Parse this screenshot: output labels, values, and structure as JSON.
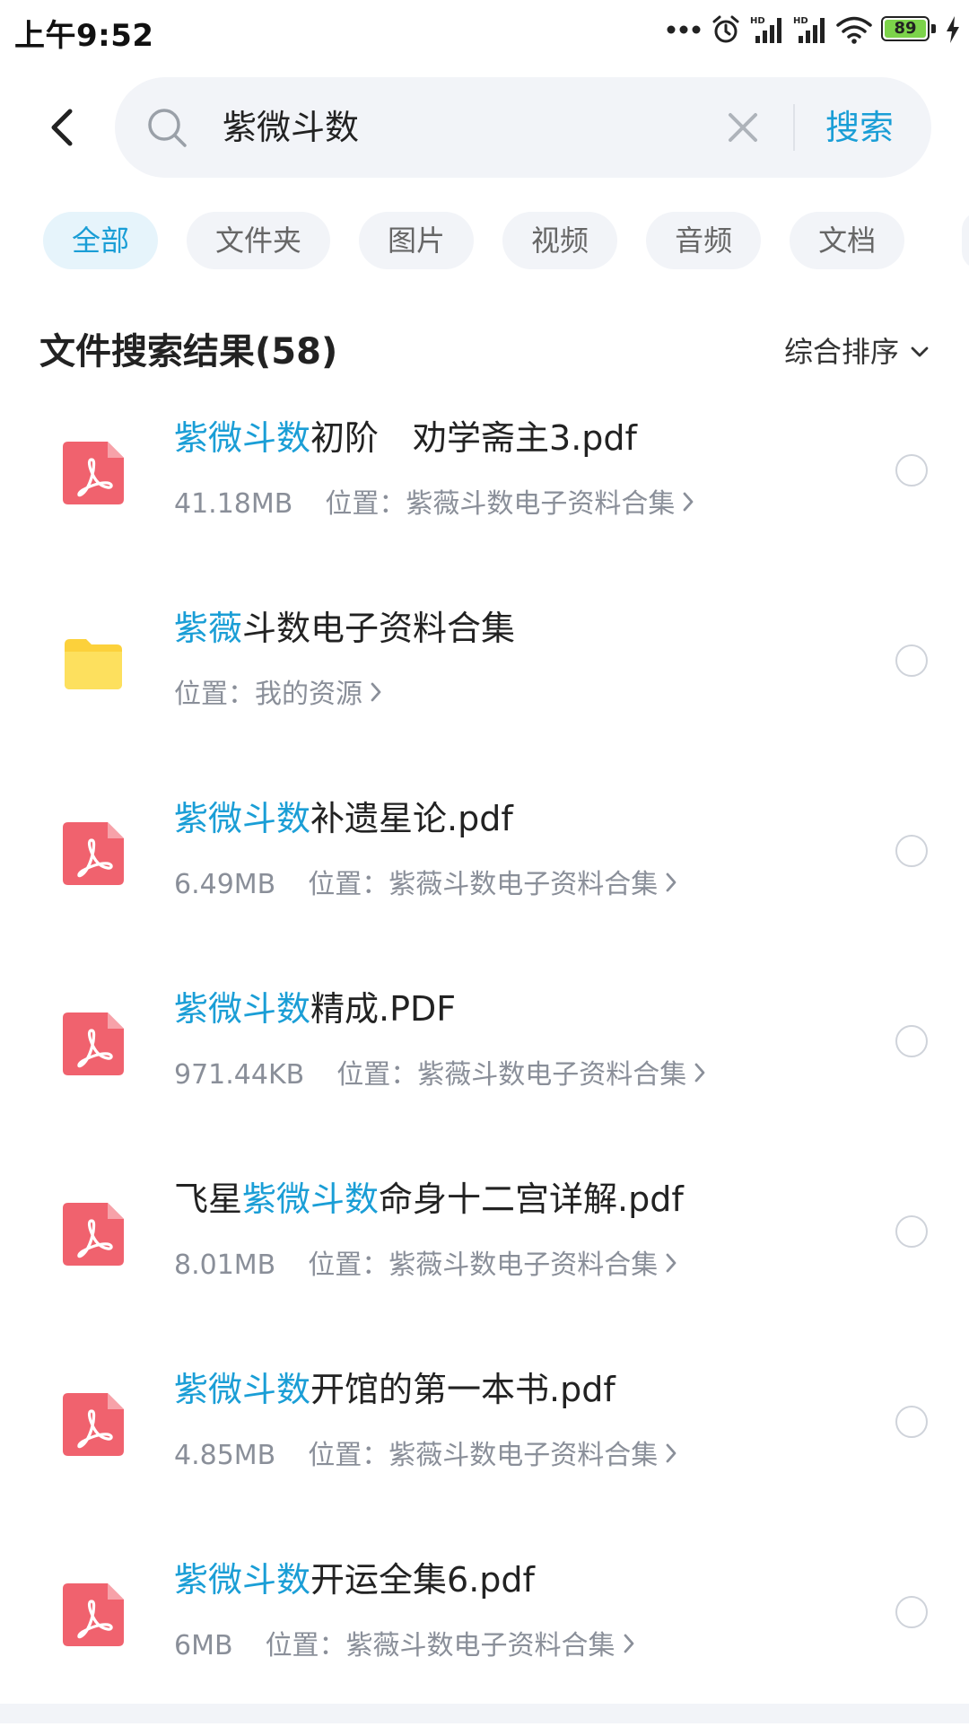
{
  "status_bar": {
    "time": "上午9:52",
    "battery": "89"
  },
  "search": {
    "query": "紫微斗数",
    "submit_label": "搜索"
  },
  "filters": [
    "全部",
    "文件夹",
    "图片",
    "视频",
    "音频",
    "文档"
  ],
  "results": {
    "title": "文件搜索结果(58)",
    "sort_label": "综合排序"
  },
  "files": [
    {
      "type": "pdf",
      "prefix": "",
      "highlight": "紫微斗数",
      "suffix": "初阶　劝学斋主3.pdf",
      "size": "41.18MB",
      "location": "位置：紫薇斗数电子资料合集"
    },
    {
      "type": "folder",
      "prefix": "",
      "highlight": "紫薇",
      "suffix": "斗数电子资料合集",
      "size": "",
      "location": "位置：我的资源"
    },
    {
      "type": "pdf",
      "prefix": "",
      "highlight": "紫微斗数",
      "suffix": "补遗星论.pdf",
      "size": "6.49MB",
      "location": "位置：紫薇斗数电子资料合集"
    },
    {
      "type": "pdf",
      "prefix": "",
      "highlight": "紫微斗数",
      "suffix": "精成.PDF",
      "size": "971.44KB",
      "location": "位置：紫薇斗数电子资料合集"
    },
    {
      "type": "pdf",
      "prefix": "飞星",
      "highlight": "紫微斗数",
      "suffix": "命身十二宫详解.pdf",
      "size": "8.01MB",
      "location": "位置：紫薇斗数电子资料合集"
    },
    {
      "type": "pdf",
      "prefix": "",
      "highlight": "紫微斗数",
      "suffix": "开馆的第一本书.pdf",
      "size": "4.85MB",
      "location": "位置：紫薇斗数电子资料合集"
    },
    {
      "type": "pdf",
      "prefix": "",
      "highlight": "紫微斗数",
      "suffix": "开运全集6.pdf",
      "size": "6MB",
      "location": "位置：紫薇斗数电子资料合集"
    }
  ],
  "colors": {
    "accent": "#1a9ed6",
    "pdf_icon": "#f0626e",
    "folder_icon": "#fcd13b",
    "battery": "#7cd34a"
  }
}
